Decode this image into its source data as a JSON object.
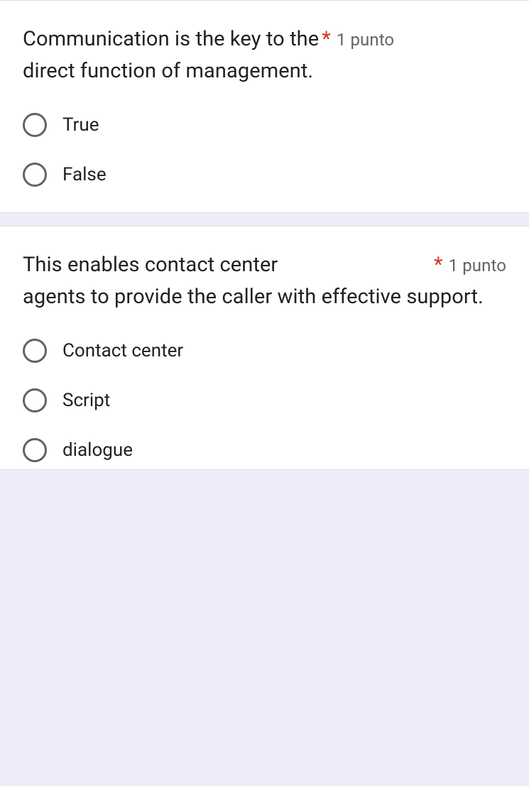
{
  "questions": [
    {
      "text_line1": "Communication is the key to the",
      "text_line2": "direct function of management.",
      "required_mark": "*",
      "points": "1 punto",
      "options": [
        "True",
        "False"
      ]
    },
    {
      "text_line1": "This enables contact center",
      "text_line2": "agents to provide the caller with effective support.",
      "required_mark": "*",
      "points": "1 punto",
      "options": [
        "Contact center",
        "Script",
        "dialogue"
      ]
    }
  ]
}
